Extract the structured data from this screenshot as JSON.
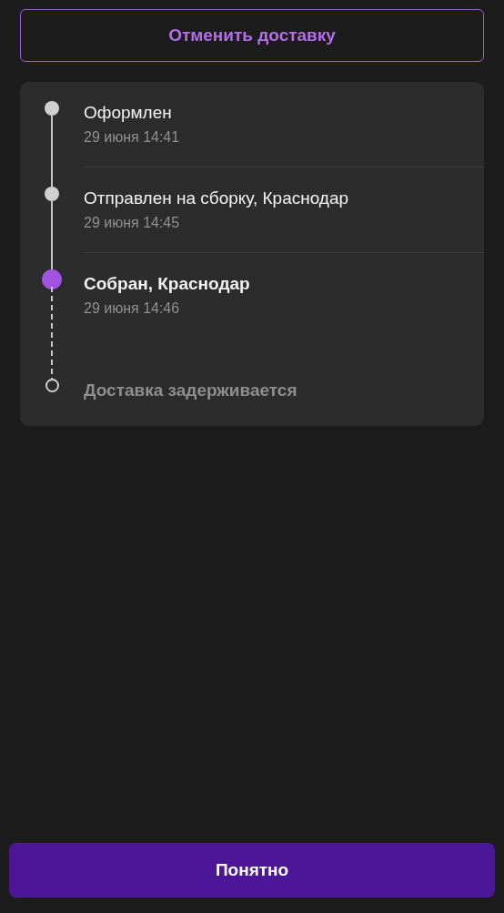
{
  "cancel_button": {
    "label": "Отменить доставку"
  },
  "timeline": [
    {
      "title": "Оформлен",
      "date": "29 июня 14:41",
      "kind": "done"
    },
    {
      "title": "Отправлен на сборку, Краснодар",
      "date": "29 июня 14:45",
      "kind": "done"
    },
    {
      "title": "Собран, Краснодар",
      "date": "29 июня 14:46",
      "kind": "current"
    },
    {
      "title": "Доставка задерживается",
      "kind": "pending"
    }
  ],
  "ok_button": {
    "label": "Понятно"
  }
}
